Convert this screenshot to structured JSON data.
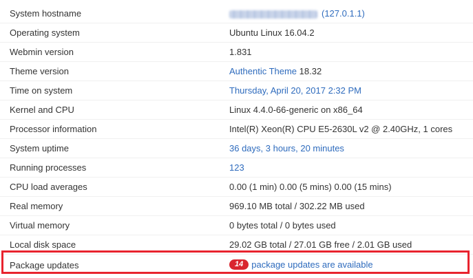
{
  "rows": [
    {
      "label": "System hostname",
      "value_redacted": true,
      "value_link": "(127.0.1.1)"
    },
    {
      "label": "Operating system",
      "value": "Ubuntu Linux 16.04.2"
    },
    {
      "label": "Webmin version",
      "value": "1.831"
    },
    {
      "label": "Theme version",
      "value_link": "Authentic Theme",
      "value_suffix": " 18.32"
    },
    {
      "label": "Time on system",
      "value_link": "Thursday, April 20, 2017 2:32 PM"
    },
    {
      "label": "Kernel and CPU",
      "value": "Linux 4.4.0-66-generic on x86_64"
    },
    {
      "label": "Processor information",
      "value": "Intel(R) Xeon(R) CPU E5-2630L v2 @ 2.40GHz, 1 cores"
    },
    {
      "label": "System uptime",
      "value_link": "36 days, 3 hours, 20 minutes"
    },
    {
      "label": "Running processes",
      "value_link": "123"
    },
    {
      "label": "CPU load averages",
      "value": "0.00 (1 min) 0.00 (5 mins) 0.00 (15 mins)"
    },
    {
      "label": "Real memory",
      "value": "969.10 MB total / 302.22 MB used"
    },
    {
      "label": "Virtual memory",
      "value": "0 bytes total / 0 bytes used"
    },
    {
      "label": "Local disk space",
      "value": "29.02 GB total / 27.01 GB free / 2.01 GB used"
    },
    {
      "label": "Package updates",
      "badge": "14",
      "value_link": "package updates are available"
    }
  ],
  "colors": {
    "link": "#2e6bbd",
    "highlight_border": "#e8232e",
    "badge_bg": "#d9262f"
  }
}
